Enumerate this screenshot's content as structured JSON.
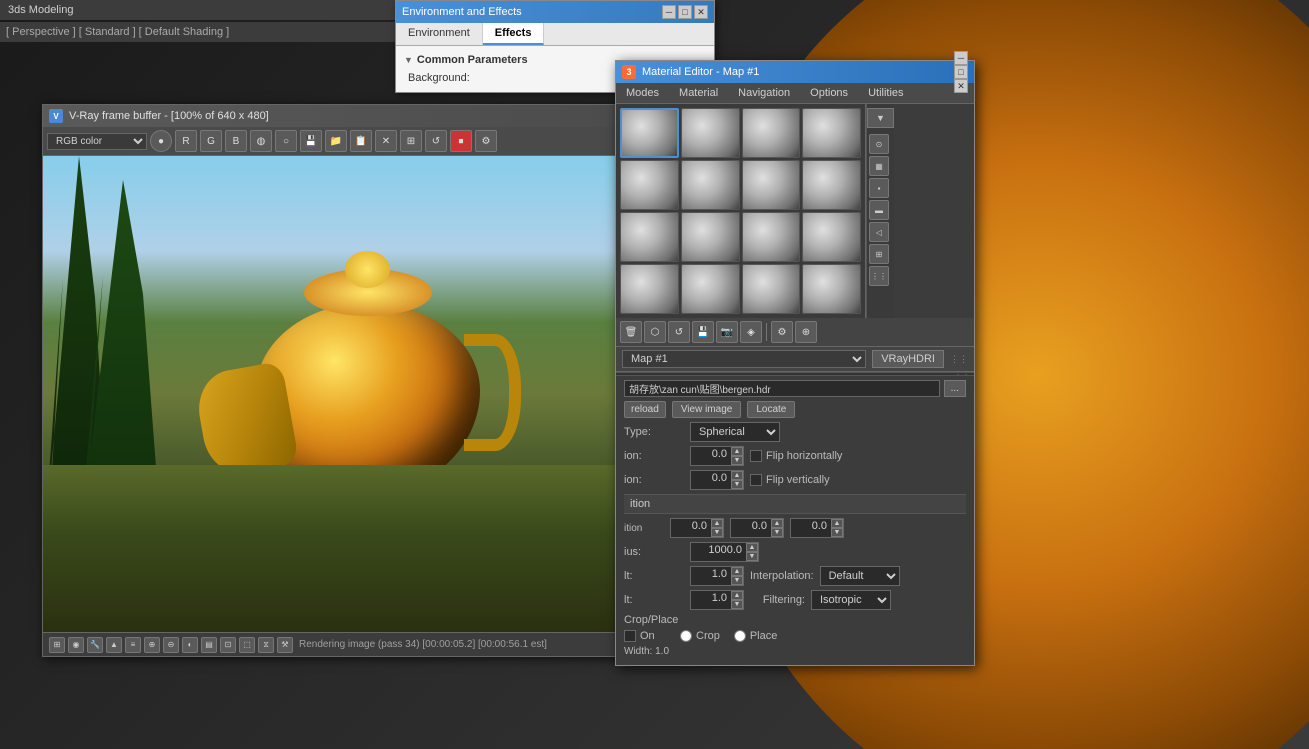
{
  "app": {
    "title": "3ds Modeling"
  },
  "topbar": {
    "label": "[ Perspective ] [ Standard ] [ Default Shading ]"
  },
  "vray_framebuffer": {
    "title": "V-Ray frame buffer - [100% of 640 x 480]",
    "color_mode": "RGB color",
    "status_text": "Rendering image (pass 34) [00:00:05.2] [00:00:56.1 est]",
    "toolbar_btns": [
      "R",
      "G",
      "B",
      "●",
      "○",
      "💾",
      "📁",
      "📋",
      "✕",
      "⊞",
      "🔄",
      "⏹",
      "🔧"
    ]
  },
  "env_effects": {
    "title": "Environment and Effects",
    "tabs": [
      "Environment",
      "Effects"
    ],
    "active_tab": "Effects",
    "section": "Common Parameters",
    "background_label": "Background:"
  },
  "material_editor": {
    "title": "Material Editor - Map #1",
    "num": "3",
    "menu_items": [
      "Modes",
      "Material",
      "Navigation",
      "Options",
      "Utilities"
    ],
    "map_name": "Map #1",
    "map_type": "VRayHDRI",
    "file_path": "胡存放\\zan cun\\贴图\\bergen.hdr",
    "action_btns": [
      "reload",
      "View image",
      "Locate"
    ],
    "reload_label": "reload",
    "view_image_label": "View image",
    "locate_label": "Locate",
    "type_label": "Type:",
    "type_value": "Spherical",
    "horiz_rotation_label": "ion:",
    "horiz_rotation_value": "0.0",
    "vert_rotation_label": "ion:",
    "vert_rotation_value": "0.0",
    "flip_h_label": "Flip horizontally",
    "flip_v_label": "Flip vertically",
    "position_section": "ition",
    "position_x": "0.0",
    "position_y": "0.0",
    "position_z": "0.0",
    "radius_label": "ius:",
    "radius_value": "1000.0",
    "default1_label": "lt:",
    "default1_value": "1.0",
    "interpolation_label": "Interpolation:",
    "interpolation_value": "Default",
    "default2_label": "lt:",
    "default2_value": "1.0",
    "filtering_label": "Filtering:",
    "filtering_value": "Isotropic",
    "crop_place_label": "Crop/Place",
    "crop_label": "On",
    "crop_radio": "Crop",
    "place_radio": "Place",
    "spheres": [
      {
        "row": 0,
        "col": 0
      },
      {
        "row": 0,
        "col": 1
      },
      {
        "row": 0,
        "col": 2
      },
      {
        "row": 0,
        "col": 3
      },
      {
        "row": 1,
        "col": 0
      },
      {
        "row": 1,
        "col": 1
      },
      {
        "row": 1,
        "col": 2
      },
      {
        "row": 1,
        "col": 3
      },
      {
        "row": 2,
        "col": 0
      },
      {
        "row": 2,
        "col": 1
      },
      {
        "row": 2,
        "col": 2
      },
      {
        "row": 2,
        "col": 3
      },
      {
        "row": 3,
        "col": 0
      },
      {
        "row": 3,
        "col": 1
      },
      {
        "row": 3,
        "col": 2
      },
      {
        "row": 3,
        "col": 3
      }
    ]
  },
  "colors": {
    "active_blue": "#4a90d9",
    "title_grad_start": "#4a90d9",
    "bg_dark": "#3c3c3c",
    "bg_darker": "#2b2b2b"
  }
}
